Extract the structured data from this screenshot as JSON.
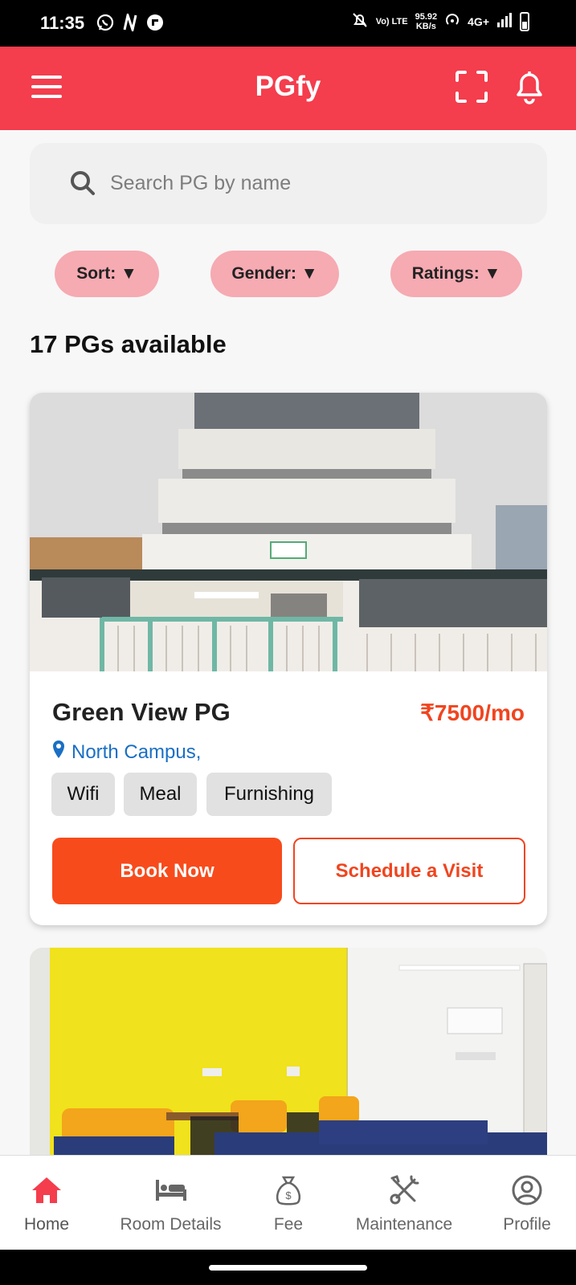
{
  "status_bar": {
    "time": "11:35",
    "network_speed_value": "95.92",
    "network_speed_unit": "KB/s",
    "volte": "Vo) LTE",
    "network_type": "4G+"
  },
  "header": {
    "title": "PGfy"
  },
  "search": {
    "placeholder": "Search PG by name"
  },
  "filters": [
    {
      "label": "Sort: ▼"
    },
    {
      "label": "Gender: ▼"
    },
    {
      "label": "Ratings: ▼"
    }
  ],
  "listing_count": "17 PGs available",
  "listings": [
    {
      "name": "Green View PG",
      "price": "₹7500/mo",
      "location": "North Campus,",
      "amenities": [
        "Wifi",
        "Meal",
        "Furnishing"
      ],
      "book_label": "Book Now",
      "visit_label": "Schedule a Visit"
    }
  ],
  "bottom_nav": [
    {
      "label": "Home",
      "icon": "home-icon",
      "active": true
    },
    {
      "label": "Room Details",
      "icon": "bed-icon",
      "active": false
    },
    {
      "label": "Fee",
      "icon": "money-bag-icon",
      "active": false
    },
    {
      "label": "Maintenance",
      "icon": "tools-icon",
      "active": false
    },
    {
      "label": "Profile",
      "icon": "user-circle-icon",
      "active": false
    }
  ],
  "colors": {
    "header": "#f43d4d",
    "filter_pill": "#f6aab2",
    "accent": "#f74b1c",
    "price": "#f0451f",
    "location": "#1a6fc4",
    "nav_active": "#f43d4d"
  }
}
